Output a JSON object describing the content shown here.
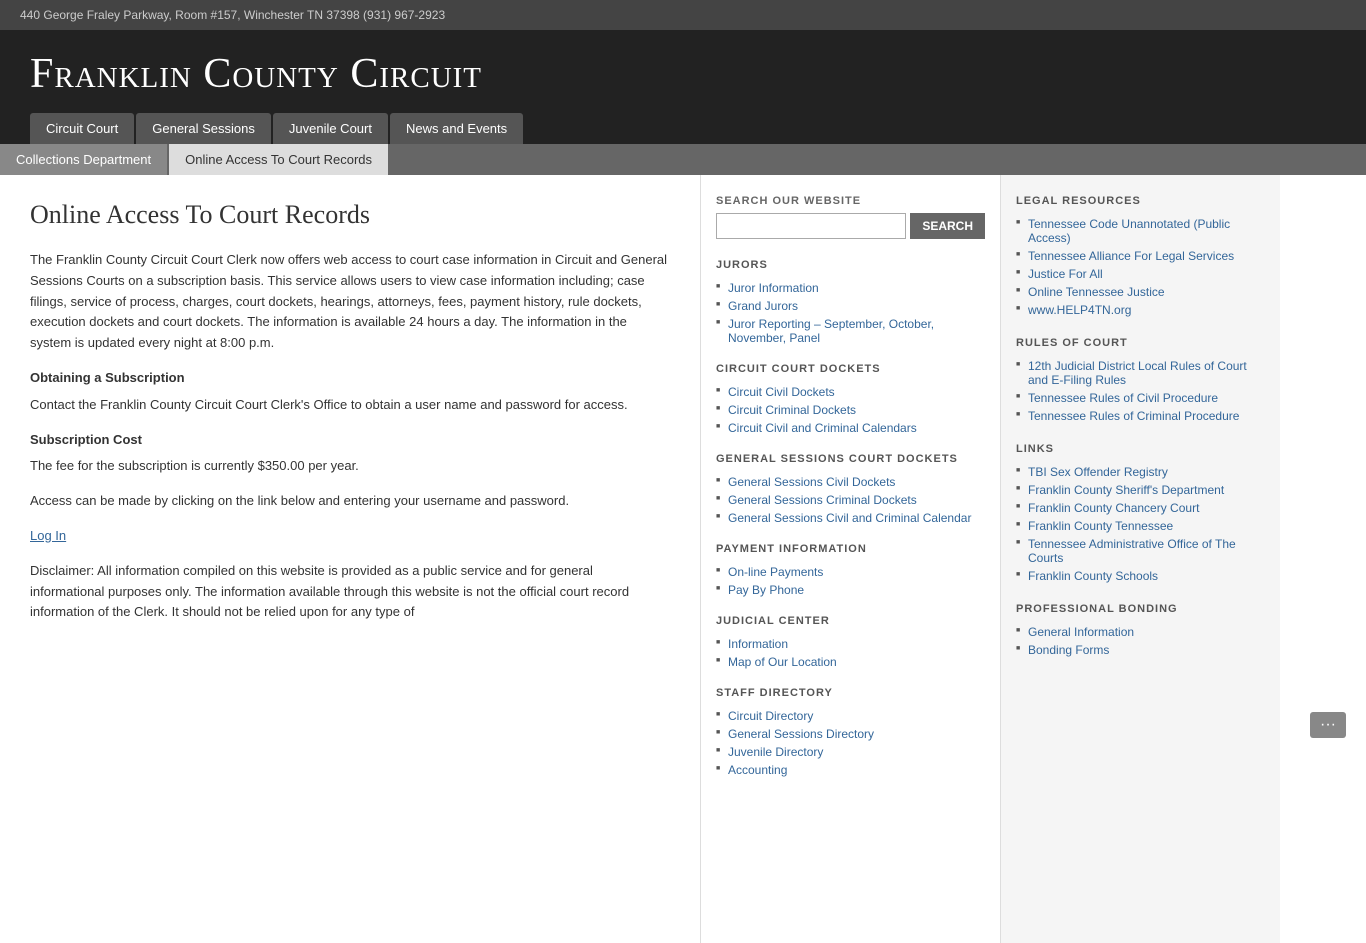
{
  "topbar": {
    "address": "440 George Fraley Parkway, Room #157, Winchester TN 37398 (931) 967-2923"
  },
  "header": {
    "title": "Franklin County Circuit"
  },
  "nav": {
    "tabs": [
      {
        "label": "Circuit Court",
        "active": false
      },
      {
        "label": "General Sessions",
        "active": false
      },
      {
        "label": "Juvenile Court",
        "active": false
      },
      {
        "label": "News and Events",
        "active": false
      }
    ],
    "subtabs": [
      {
        "label": "Collections Department",
        "active": false
      },
      {
        "label": "Online Access To Court Records",
        "active": true
      }
    ]
  },
  "main": {
    "page_title": "Online Access To Court Records",
    "paragraphs": [
      "The Franklin County Circuit Court Clerk now offers web access to court case information in Circuit and General Sessions Courts on a subscription basis.  This service allows users to view case information including; case filings, service of process, charges, court dockets, hearings, attorneys, fees, payment history, rule dockets, execution dockets and court dockets.  The information is available 24 hours a day.  The information in the system is updated every night at 8:00 p.m.",
      "Contact the Franklin County Circuit Court Clerk's Office to obtain a user name and password for access.",
      "The fee for the subscription is currently $350.00 per year.",
      "Access can be made by clicking on the link below and entering your username and password.",
      "Disclaimer: All information compiled on this website is provided as a public service and for general informational purposes only. The information available through this website is not the official court record information of the Clerk. It should not be relied upon for any type of"
    ],
    "sections": [
      {
        "heading": "Obtaining a Subscription",
        "text": "Contact the Franklin County Circuit Court Clerk's Office to obtain a user name and password for access."
      },
      {
        "heading": "Subscription Cost",
        "text": "The fee for the subscription is currently $350.00 per year."
      }
    ],
    "access_text": "Access can be made by clicking on the link below and entering your username and password.",
    "login_link": "Log In",
    "disclaimer": "Disclaimer: All information compiled on this website is provided as a public service and for general informational purposes only. The information available through this website is not the official court record information of the Clerk. It should not be relied upon for any type of"
  },
  "sidebar": {
    "search": {
      "label": "Search Our Website",
      "placeholder": "",
      "button_label": "SEARCH"
    },
    "jurors": {
      "title": "JURORS",
      "links": [
        "Juror Information",
        "Grand Jurors",
        "Juror Reporting – September, October, November, Panel"
      ]
    },
    "circuit_dockets": {
      "title": "CIRCUIT COURT DOCKETS",
      "links": [
        "Circuit Civil Dockets",
        "Circuit Criminal Dockets",
        "Circuit Civil and Criminal Calendars"
      ]
    },
    "general_sessions_dockets": {
      "title": "GENERAL SESSIONS COURT DOCKETS",
      "links": [
        "General Sessions Civil Dockets",
        "General Sessions Criminal Dockets",
        "General Sessions Civil and Criminal Calendar"
      ]
    },
    "payment": {
      "title": "PAYMENT INFORMATION",
      "links": [
        "On-line Payments",
        "Pay By Phone"
      ]
    },
    "judicial": {
      "title": "JUDICIAL CENTER",
      "links": [
        "Information",
        "Map of Our Location"
      ]
    },
    "staff_directory": {
      "title": "STAFF DIRECTORY",
      "links": [
        "Circuit Directory",
        "General Sessions Directory",
        "Juvenile Directory",
        "Accounting"
      ]
    }
  },
  "right_sidebar": {
    "legal_resources": {
      "title": "LEGAL RESOURCES",
      "links": [
        "Tennessee Code Unannotated (Public Access)",
        "Tennessee Alliance For Legal Services",
        "Justice For All",
        "Online Tennessee Justice",
        "www.HELP4TN.org"
      ]
    },
    "rules_of_court": {
      "title": "RULES OF COURT",
      "links": [
        "12th Judicial District Local Rules of Court and E-Filing Rules",
        "Tennessee Rules of Civil Procedure",
        "Tennessee Rules of Criminal Procedure"
      ]
    },
    "links": {
      "title": "LINKS",
      "links": [
        "TBI Sex Offender Registry",
        "Franklin County Sheriff's Department",
        "Franklin County Chancery Court",
        "Franklin County Tennessee",
        "Tennessee Administrative Office of The Courts",
        "Franklin County Schools"
      ]
    },
    "professional_bonding": {
      "title": "PROFESSIONAL BONDING",
      "links": [
        "General Information",
        "Bonding Forms"
      ]
    }
  }
}
